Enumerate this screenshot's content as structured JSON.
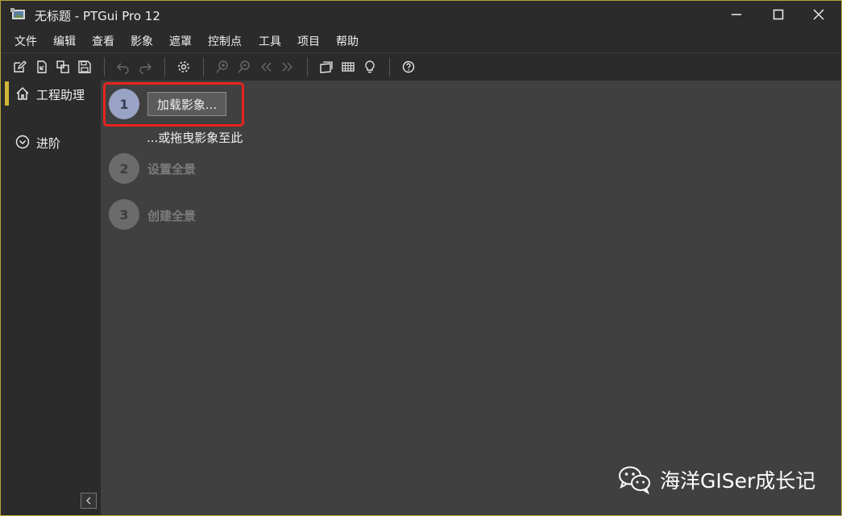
{
  "window": {
    "title": "无标题 - PTGui Pro 12",
    "border_color": "#b9a43a"
  },
  "menu": {
    "items": [
      "文件",
      "编辑",
      "查看",
      "影象",
      "遮罩",
      "控制点",
      "工具",
      "项目",
      "帮助"
    ]
  },
  "toolbar": {
    "icons": [
      "new-project-icon",
      "open-project-icon",
      "duplicate-icon",
      "save-icon",
      "undo-icon",
      "redo-icon",
      "settings-gear-icon",
      "zoom-in-icon",
      "zoom-out-icon",
      "previous-icon",
      "next-icon",
      "panorama-editor-icon",
      "table-icon",
      "lightbulb-icon",
      "help-icon"
    ]
  },
  "sidebar": {
    "items": [
      {
        "label": "工程助理",
        "icon": "home-icon",
        "active": true
      },
      {
        "label": "进阶",
        "icon": "chevron-circle-down-icon",
        "active": false
      }
    ],
    "accent_color": "#d3b638"
  },
  "assistant": {
    "steps": [
      {
        "number": "1",
        "button_label": "加载影象...",
        "hint": "...或拖曳影象至此",
        "state": "active"
      },
      {
        "number": "2",
        "label": "设置全景",
        "state": "disabled"
      },
      {
        "number": "3",
        "label": "创建全景",
        "state": "disabled"
      }
    ],
    "active_color": "#98a3c6",
    "highlight_color": "#e8221d"
  },
  "watermark": {
    "text": "海洋GISer成长记",
    "icon": "wechat-icon"
  }
}
